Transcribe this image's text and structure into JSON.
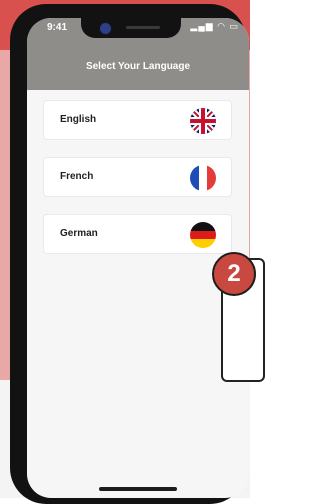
{
  "status_bar": {
    "time": "9:41",
    "icons": "signal wifi battery"
  },
  "header": {
    "title": "Select Your Language"
  },
  "languages": [
    {
      "label": "English",
      "flag": "uk-flag-icon"
    },
    {
      "label": "French",
      "flag": "france-flag-icon"
    },
    {
      "label": "German",
      "flag": "germany-flag-icon"
    }
  ],
  "badge": {
    "text": "2"
  },
  "colors": {
    "header_gray": "#8f8d8a",
    "badge_red": "#c9483f",
    "bg_red": "#d9514e",
    "bg_pink": "#e8a9a6"
  }
}
